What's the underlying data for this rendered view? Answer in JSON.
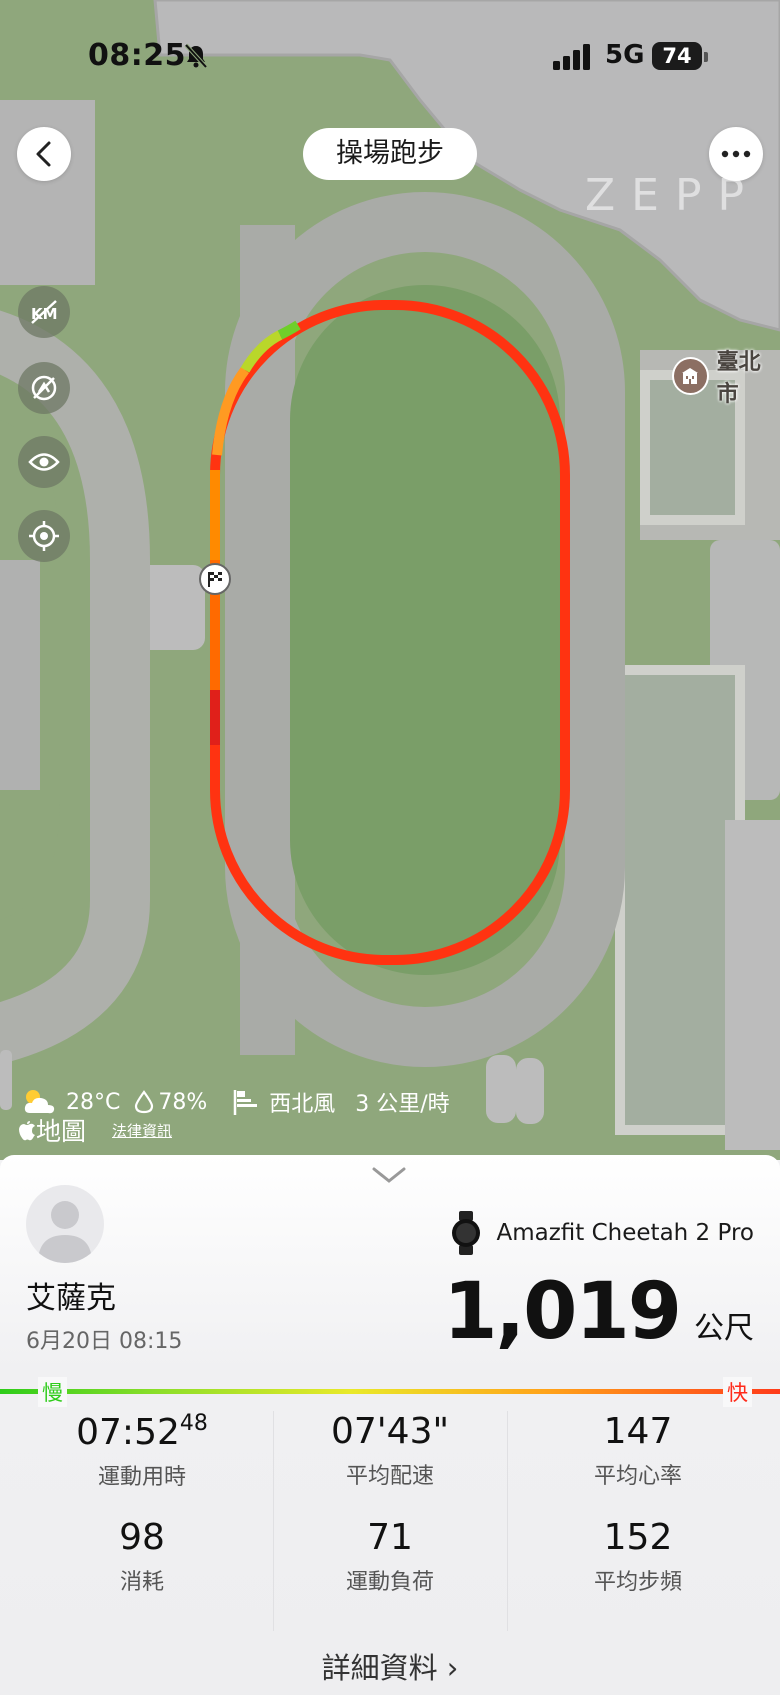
{
  "status_bar": {
    "time": "08:25",
    "network": "5G",
    "battery": "74"
  },
  "header": {
    "title": "操場跑步"
  },
  "map": {
    "watermark": "ZEPP",
    "poi_label": "臺北市",
    "attribution": "地圖",
    "legal_link": "法律資訊",
    "side_tools": [
      "km-markers-icon",
      "hide-markers-icon",
      "eye-icon",
      "locate-icon"
    ],
    "weather": {
      "temperature": "28°C",
      "humidity": "78%",
      "wind_direction": "西北風",
      "wind_speed": "3 公里/時"
    }
  },
  "summary": {
    "device": "Amazfit Cheetah 2 Pro",
    "user_name": "艾薩克",
    "date": "6月20日 08:15",
    "distance": "1,019",
    "distance_unit": "公尺",
    "pace_scale": {
      "slow": "慢",
      "fast": "快"
    },
    "stats": [
      {
        "value": "07:52",
        "sup": "48",
        "label": "運動用時"
      },
      {
        "value": "07'43\"",
        "sup": "",
        "label": "平均配速"
      },
      {
        "value": "147",
        "sup": "",
        "label": "平均心率"
      },
      {
        "value": "98",
        "sup": "",
        "label": "消耗"
      },
      {
        "value": "71",
        "sup": "",
        "label": "運動負荷"
      },
      {
        "value": "152",
        "sup": "",
        "label": "平均步頻"
      }
    ],
    "details_label": "詳細資料 ›"
  },
  "colors": {
    "track_fast": "#ff3311",
    "track_mid": "#ff8a00",
    "track_slow": "#8bd72a",
    "map_green": "#8fa77c"
  }
}
